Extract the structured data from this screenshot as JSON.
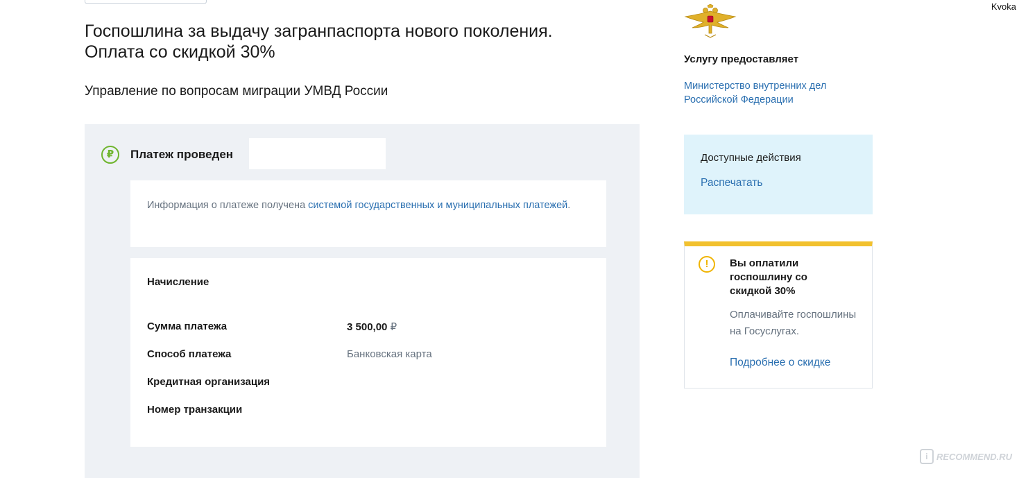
{
  "header": {
    "username": "Kvoka",
    "title": "Госпошлина за выдачу загранпаспорта нового поколения. Оплата со скидкой 30%",
    "department": "Управление по вопросам миграции УМВД России"
  },
  "payment": {
    "status_icon": "ruble-icon",
    "status_label": "Платеж проведен",
    "info_text": "Информация о платеже получена ",
    "info_link": "системой государственных и муниципальных платежей",
    "info_end": ".",
    "section_title": "Начисление",
    "rows": [
      {
        "label": "Сумма платежа",
        "value": "3 500,00",
        "currency": "₽"
      },
      {
        "label": "Способ платежа",
        "value": "Банковская карта"
      },
      {
        "label": "Кредитная организация",
        "value": ""
      },
      {
        "label": "Номер транзакции",
        "value": ""
      }
    ]
  },
  "sidebar": {
    "emblem_icon": "double-headed-eagle-emblem",
    "provider_heading": "Услугу предоставляет",
    "provider_link": "Министерство внутренних дел Российской Федерации",
    "actions": {
      "title": "Доступные действия",
      "print_label": "Распечатать"
    },
    "notice": {
      "icon": "warning-icon",
      "title": "Вы оплатили госпошлину со скидкой 30%",
      "text": "Оплачивайте госпошлины на Госуслугах.",
      "link": "Подробнее о скидке"
    }
  },
  "watermark": {
    "text": "RECOMMEND.RU",
    "badge": "i"
  },
  "colors": {
    "link": "#2a6fb0",
    "success": "#6fb52e",
    "warning": "#f2c12e",
    "panel_bg": "#eef1f5",
    "actions_bg": "#dff3fb"
  }
}
